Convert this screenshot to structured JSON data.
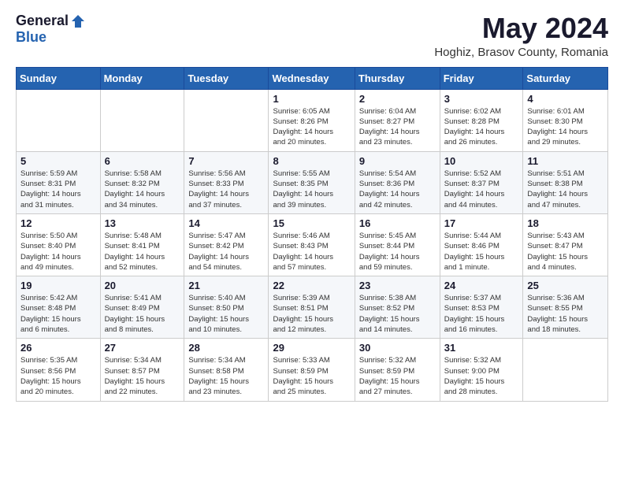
{
  "logo": {
    "general": "General",
    "blue": "Blue"
  },
  "title": "May 2024",
  "subtitle": "Hoghiz, Brasov County, Romania",
  "days_of_week": [
    "Sunday",
    "Monday",
    "Tuesday",
    "Wednesday",
    "Thursday",
    "Friday",
    "Saturday"
  ],
  "weeks": [
    [
      {
        "day": "",
        "info": ""
      },
      {
        "day": "",
        "info": ""
      },
      {
        "day": "",
        "info": ""
      },
      {
        "day": "1",
        "info": "Sunrise: 6:05 AM\nSunset: 8:26 PM\nDaylight: 14 hours\nand 20 minutes."
      },
      {
        "day": "2",
        "info": "Sunrise: 6:04 AM\nSunset: 8:27 PM\nDaylight: 14 hours\nand 23 minutes."
      },
      {
        "day": "3",
        "info": "Sunrise: 6:02 AM\nSunset: 8:28 PM\nDaylight: 14 hours\nand 26 minutes."
      },
      {
        "day": "4",
        "info": "Sunrise: 6:01 AM\nSunset: 8:30 PM\nDaylight: 14 hours\nand 29 minutes."
      }
    ],
    [
      {
        "day": "5",
        "info": "Sunrise: 5:59 AM\nSunset: 8:31 PM\nDaylight: 14 hours\nand 31 minutes."
      },
      {
        "day": "6",
        "info": "Sunrise: 5:58 AM\nSunset: 8:32 PM\nDaylight: 14 hours\nand 34 minutes."
      },
      {
        "day": "7",
        "info": "Sunrise: 5:56 AM\nSunset: 8:33 PM\nDaylight: 14 hours\nand 37 minutes."
      },
      {
        "day": "8",
        "info": "Sunrise: 5:55 AM\nSunset: 8:35 PM\nDaylight: 14 hours\nand 39 minutes."
      },
      {
        "day": "9",
        "info": "Sunrise: 5:54 AM\nSunset: 8:36 PM\nDaylight: 14 hours\nand 42 minutes."
      },
      {
        "day": "10",
        "info": "Sunrise: 5:52 AM\nSunset: 8:37 PM\nDaylight: 14 hours\nand 44 minutes."
      },
      {
        "day": "11",
        "info": "Sunrise: 5:51 AM\nSunset: 8:38 PM\nDaylight: 14 hours\nand 47 minutes."
      }
    ],
    [
      {
        "day": "12",
        "info": "Sunrise: 5:50 AM\nSunset: 8:40 PM\nDaylight: 14 hours\nand 49 minutes."
      },
      {
        "day": "13",
        "info": "Sunrise: 5:48 AM\nSunset: 8:41 PM\nDaylight: 14 hours\nand 52 minutes."
      },
      {
        "day": "14",
        "info": "Sunrise: 5:47 AM\nSunset: 8:42 PM\nDaylight: 14 hours\nand 54 minutes."
      },
      {
        "day": "15",
        "info": "Sunrise: 5:46 AM\nSunset: 8:43 PM\nDaylight: 14 hours\nand 57 minutes."
      },
      {
        "day": "16",
        "info": "Sunrise: 5:45 AM\nSunset: 8:44 PM\nDaylight: 14 hours\nand 59 minutes."
      },
      {
        "day": "17",
        "info": "Sunrise: 5:44 AM\nSunset: 8:46 PM\nDaylight: 15 hours\nand 1 minute."
      },
      {
        "day": "18",
        "info": "Sunrise: 5:43 AM\nSunset: 8:47 PM\nDaylight: 15 hours\nand 4 minutes."
      }
    ],
    [
      {
        "day": "19",
        "info": "Sunrise: 5:42 AM\nSunset: 8:48 PM\nDaylight: 15 hours\nand 6 minutes."
      },
      {
        "day": "20",
        "info": "Sunrise: 5:41 AM\nSunset: 8:49 PM\nDaylight: 15 hours\nand 8 minutes."
      },
      {
        "day": "21",
        "info": "Sunrise: 5:40 AM\nSunset: 8:50 PM\nDaylight: 15 hours\nand 10 minutes."
      },
      {
        "day": "22",
        "info": "Sunrise: 5:39 AM\nSunset: 8:51 PM\nDaylight: 15 hours\nand 12 minutes."
      },
      {
        "day": "23",
        "info": "Sunrise: 5:38 AM\nSunset: 8:52 PM\nDaylight: 15 hours\nand 14 minutes."
      },
      {
        "day": "24",
        "info": "Sunrise: 5:37 AM\nSunset: 8:53 PM\nDaylight: 15 hours\nand 16 minutes."
      },
      {
        "day": "25",
        "info": "Sunrise: 5:36 AM\nSunset: 8:55 PM\nDaylight: 15 hours\nand 18 minutes."
      }
    ],
    [
      {
        "day": "26",
        "info": "Sunrise: 5:35 AM\nSunset: 8:56 PM\nDaylight: 15 hours\nand 20 minutes."
      },
      {
        "day": "27",
        "info": "Sunrise: 5:34 AM\nSunset: 8:57 PM\nDaylight: 15 hours\nand 22 minutes."
      },
      {
        "day": "28",
        "info": "Sunrise: 5:34 AM\nSunset: 8:58 PM\nDaylight: 15 hours\nand 23 minutes."
      },
      {
        "day": "29",
        "info": "Sunrise: 5:33 AM\nSunset: 8:59 PM\nDaylight: 15 hours\nand 25 minutes."
      },
      {
        "day": "30",
        "info": "Sunrise: 5:32 AM\nSunset: 8:59 PM\nDaylight: 15 hours\nand 27 minutes."
      },
      {
        "day": "31",
        "info": "Sunrise: 5:32 AM\nSunset: 9:00 PM\nDaylight: 15 hours\nand 28 minutes."
      },
      {
        "day": "",
        "info": ""
      }
    ]
  ]
}
